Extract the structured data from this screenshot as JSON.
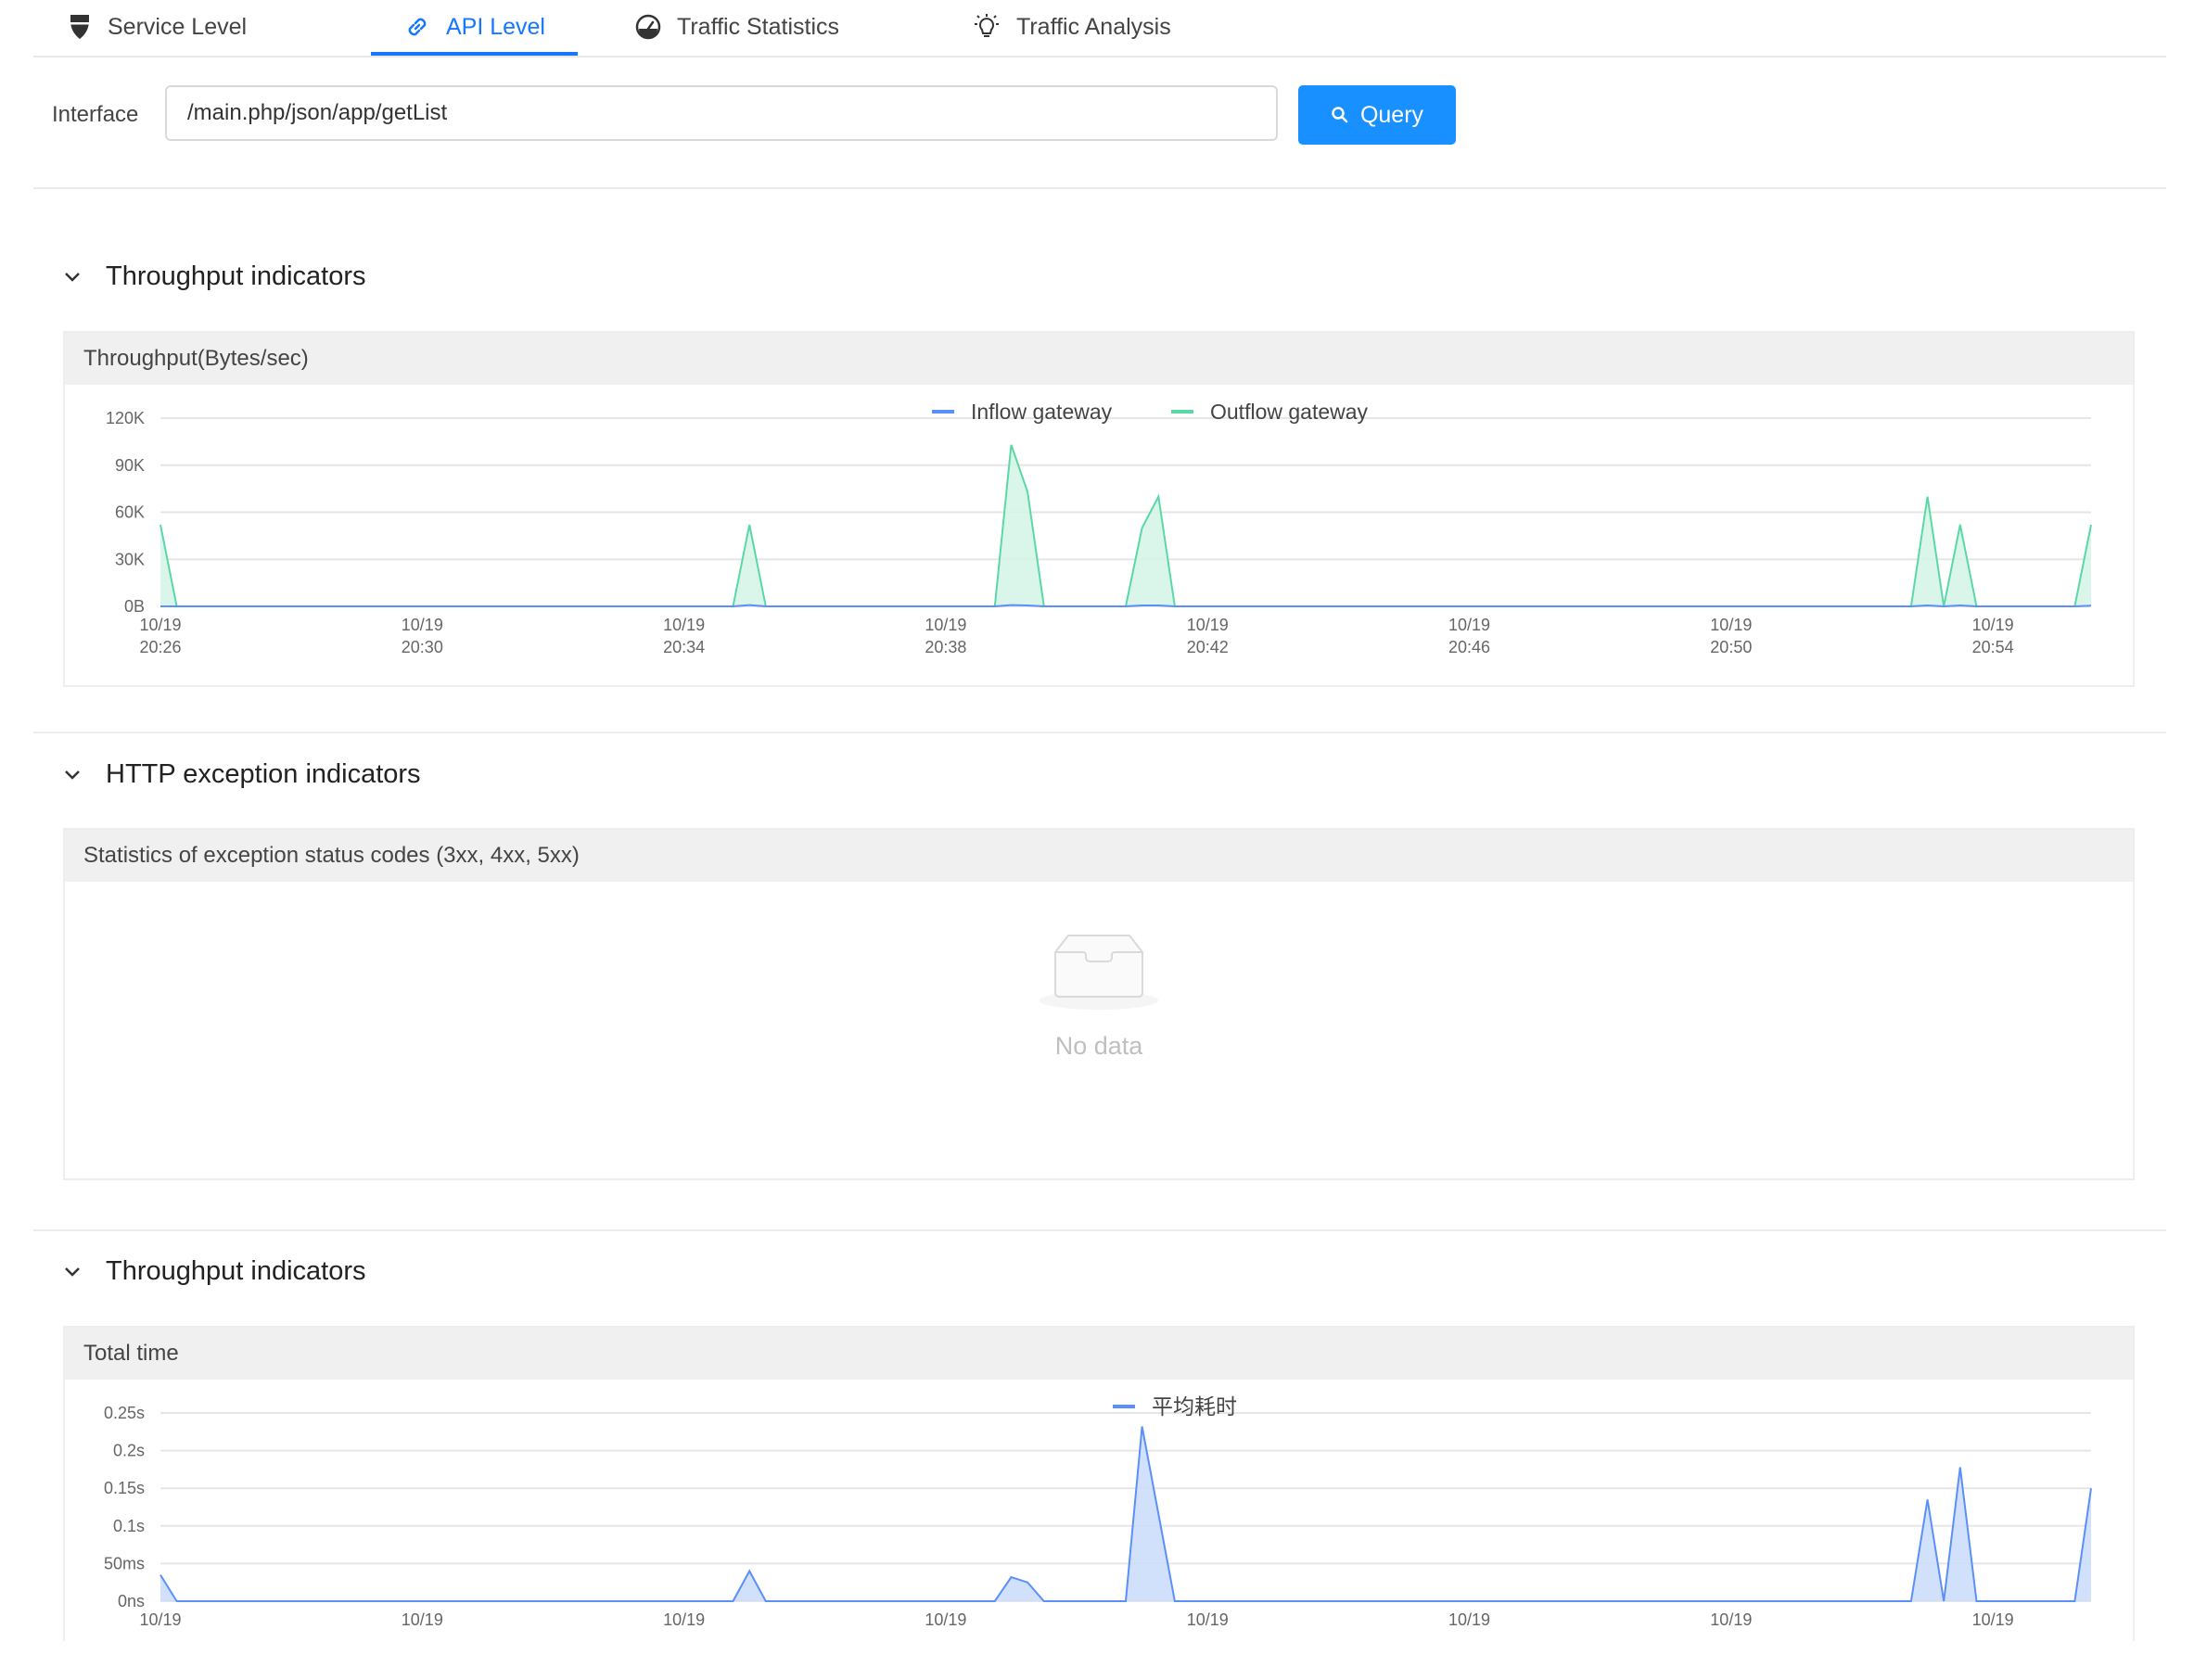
{
  "tabs": [
    {
      "label": "Service Level",
      "icon": "shield-icon"
    },
    {
      "label": "API Level",
      "icon": "link-icon"
    },
    {
      "label": "Traffic Statistics",
      "icon": "gauge-icon"
    },
    {
      "label": "Traffic Analysis",
      "icon": "lightbulb-icon"
    }
  ],
  "active_tab": "API Level",
  "query": {
    "label": "Interface",
    "value": "/main.php/json/app/getList",
    "button_label": "Query",
    "button_icon": "search-icon"
  },
  "sections": [
    {
      "title": "Throughput indicators",
      "panel_title": "Throughput(Bytes/sec)"
    },
    {
      "title": "HTTP exception indicators",
      "panel_title": "Statistics of exception status codes (3xx, 4xx, 5xx)",
      "empty_text": "No data"
    },
    {
      "title": "Throughput indicators",
      "panel_title": "Total time"
    }
  ],
  "colors": {
    "accent": "#1677ff",
    "button": "#1890ff",
    "inflow": "#5b8ff9",
    "outflow": "#5ad8a6",
    "outflow_fill": "#d4f3e6",
    "avg_fill": "#c9dcfb"
  },
  "chart_data": [
    {
      "type": "area",
      "title": "Throughput(Bytes/sec)",
      "x_tick_labels": [
        [
          "10/19",
          "20:26"
        ],
        [
          "10/19",
          "20:30"
        ],
        [
          "10/19",
          "20:34"
        ],
        [
          "10/19",
          "20:38"
        ],
        [
          "10/19",
          "20:42"
        ],
        [
          "10/19",
          "20:46"
        ],
        [
          "10/19",
          "20:50"
        ],
        [
          "10/19",
          "20:54"
        ]
      ],
      "x_range_minutes": [
        0,
        29.5
      ],
      "y_tick_labels": [
        "0B",
        "30K",
        "60K",
        "90K",
        "120K"
      ],
      "ylim": [
        0,
        120000
      ],
      "grid": true,
      "legend_position": "top-center",
      "series": [
        {
          "name": "Inflow gateway",
          "color": "#5b8ff9",
          "points": [
            [
              0,
              0
            ],
            [
              0.25,
              0
            ],
            [
              8.75,
              0
            ],
            [
              9,
              800
            ],
            [
              9.25,
              0
            ],
            [
              12.75,
              0
            ],
            [
              13,
              800
            ],
            [
              13.25,
              600
            ],
            [
              13.5,
              0
            ],
            [
              14.75,
              0
            ],
            [
              15,
              600
            ],
            [
              15.25,
              600
            ],
            [
              15.5,
              0
            ],
            [
              26.75,
              0
            ],
            [
              27,
              600
            ],
            [
              27.25,
              0
            ],
            [
              27.5,
              600
            ],
            [
              27.75,
              0
            ],
            [
              29.25,
              0
            ],
            [
              29.5,
              400
            ]
          ]
        },
        {
          "name": "Outflow gateway",
          "color": "#5ad8a6",
          "points": [
            [
              0,
              52000
            ],
            [
              0.25,
              0
            ],
            [
              8.75,
              0
            ],
            [
              9,
              52000
            ],
            [
              9.25,
              0
            ],
            [
              12.75,
              0
            ],
            [
              13,
              103000
            ],
            [
              13.25,
              73000
            ],
            [
              13.5,
              0
            ],
            [
              14.75,
              0
            ],
            [
              15,
              50000
            ],
            [
              15.25,
              70000
            ],
            [
              15.5,
              0
            ],
            [
              26.75,
              0
            ],
            [
              27,
              70000
            ],
            [
              27.25,
              0
            ],
            [
              27.5,
              52000
            ],
            [
              27.75,
              0
            ],
            [
              29.25,
              0
            ],
            [
              29.5,
              52000
            ]
          ]
        }
      ]
    },
    {
      "type": "area",
      "title": "Total time",
      "x_tick_labels": [
        [
          "10/19",
          ""
        ],
        [
          "10/19",
          ""
        ],
        [
          "10/19",
          ""
        ],
        [
          "10/19",
          ""
        ],
        [
          "10/19",
          ""
        ],
        [
          "10/19",
          ""
        ],
        [
          "10/19",
          ""
        ],
        [
          "10/19",
          ""
        ]
      ],
      "x_range_minutes": [
        0,
        29.5
      ],
      "y_tick_labels": [
        "0ns",
        "50ms",
        "0.1s",
        "0.15s",
        "0.2s",
        "0.25s"
      ],
      "ylim": [
        0,
        0.25
      ],
      "grid": true,
      "legend_position": "top-center",
      "series": [
        {
          "name": "平均耗时",
          "color": "#5b8ff9",
          "points": [
            [
              0,
              0.035
            ],
            [
              0.25,
              0
            ],
            [
              8.75,
              0
            ],
            [
              9,
              0.04
            ],
            [
              9.25,
              0
            ],
            [
              12.75,
              0
            ],
            [
              13,
              0.032
            ],
            [
              13.25,
              0.025
            ],
            [
              13.5,
              0
            ],
            [
              14.75,
              0
            ],
            [
              15,
              0.232
            ],
            [
              15.5,
              0
            ],
            [
              26.75,
              0
            ],
            [
              27,
              0.135
            ],
            [
              27.25,
              0
            ],
            [
              27.5,
              0.178
            ],
            [
              27.75,
              0
            ],
            [
              29.25,
              0
            ],
            [
              29.5,
              0.15
            ]
          ]
        }
      ]
    }
  ]
}
